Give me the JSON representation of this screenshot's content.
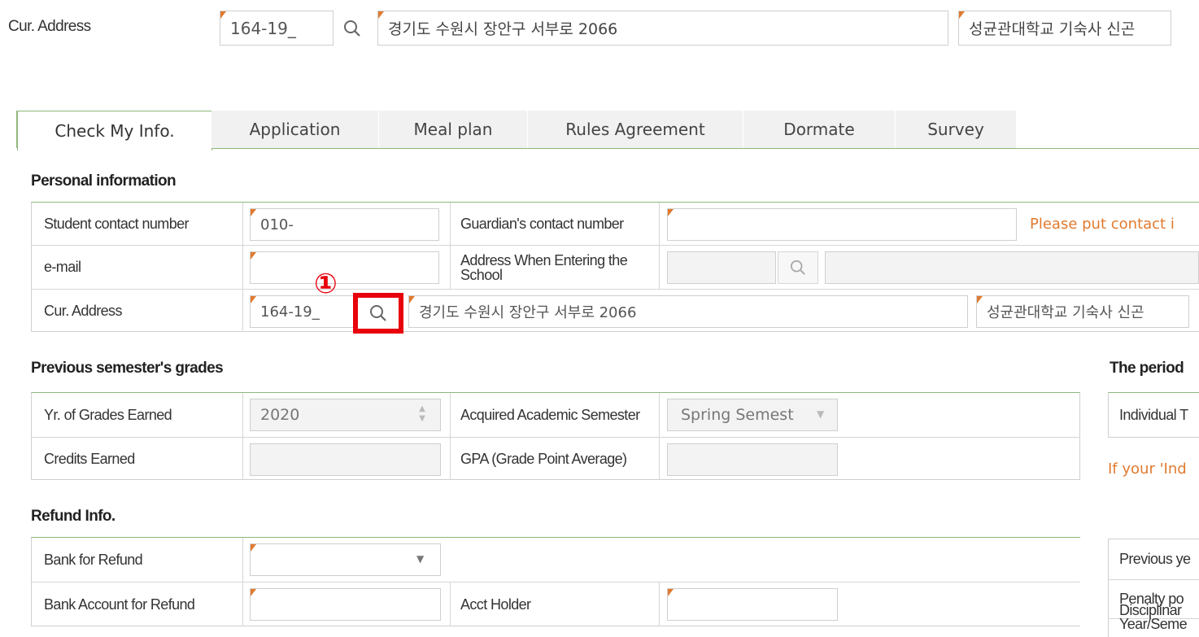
{
  "top_address": {
    "label": "Cur. Address",
    "postal": "164-19_",
    "road": "경기도 수원시 장안구 서부로 2066",
    "detail": "성균관대학교 기숙사 신곤"
  },
  "tabs": [
    {
      "label": "Check My Info.",
      "active": true
    },
    {
      "label": "Application"
    },
    {
      "label": "Meal plan"
    },
    {
      "label": "Rules Agreement"
    },
    {
      "label": "Dormate"
    },
    {
      "label": "Survey"
    }
  ],
  "personal": {
    "title": "Personal information",
    "student_contact_label": "Student contact number",
    "student_contact_value": "010-",
    "guardian_label": "Guardian's contact number",
    "guardian_note": "Please put contact i",
    "email_label": "e-mail",
    "entering_address_label": "Address When Entering the School",
    "cur_address_label": "Cur. Address",
    "cur_postal": "164-19_",
    "cur_road": "경기도 수원시 장안구 서부로 2066",
    "cur_detail": "성균관대학교 기숙사 신곤",
    "marker": "①"
  },
  "grades": {
    "title": "Previous semester's grades",
    "year_label": "Yr. of Grades Earned",
    "year_value": "2020",
    "semester_label": "Acquired Academic Semester",
    "semester_value": "Spring Semest",
    "credits_label": "Credits Earned",
    "gpa_label": "GPA (Grade Point Average)"
  },
  "refund": {
    "title": "Refund Info.",
    "bank_label": "Bank for Refund",
    "account_label": "Bank Account for Refund",
    "holder_label": "Acct Holder"
  },
  "right_panel": {
    "title": "The period",
    "individual": "Individual T",
    "if_your": "If your 'Ind",
    "previous_year": "Previous ye",
    "penalty": "Penalty po",
    "disciplinary": "Disciplinar Year/Seme"
  },
  "colors": {
    "required_marker": "#e07a2f",
    "highlight": "#e8000c",
    "tab_border": "#8fb87a"
  }
}
